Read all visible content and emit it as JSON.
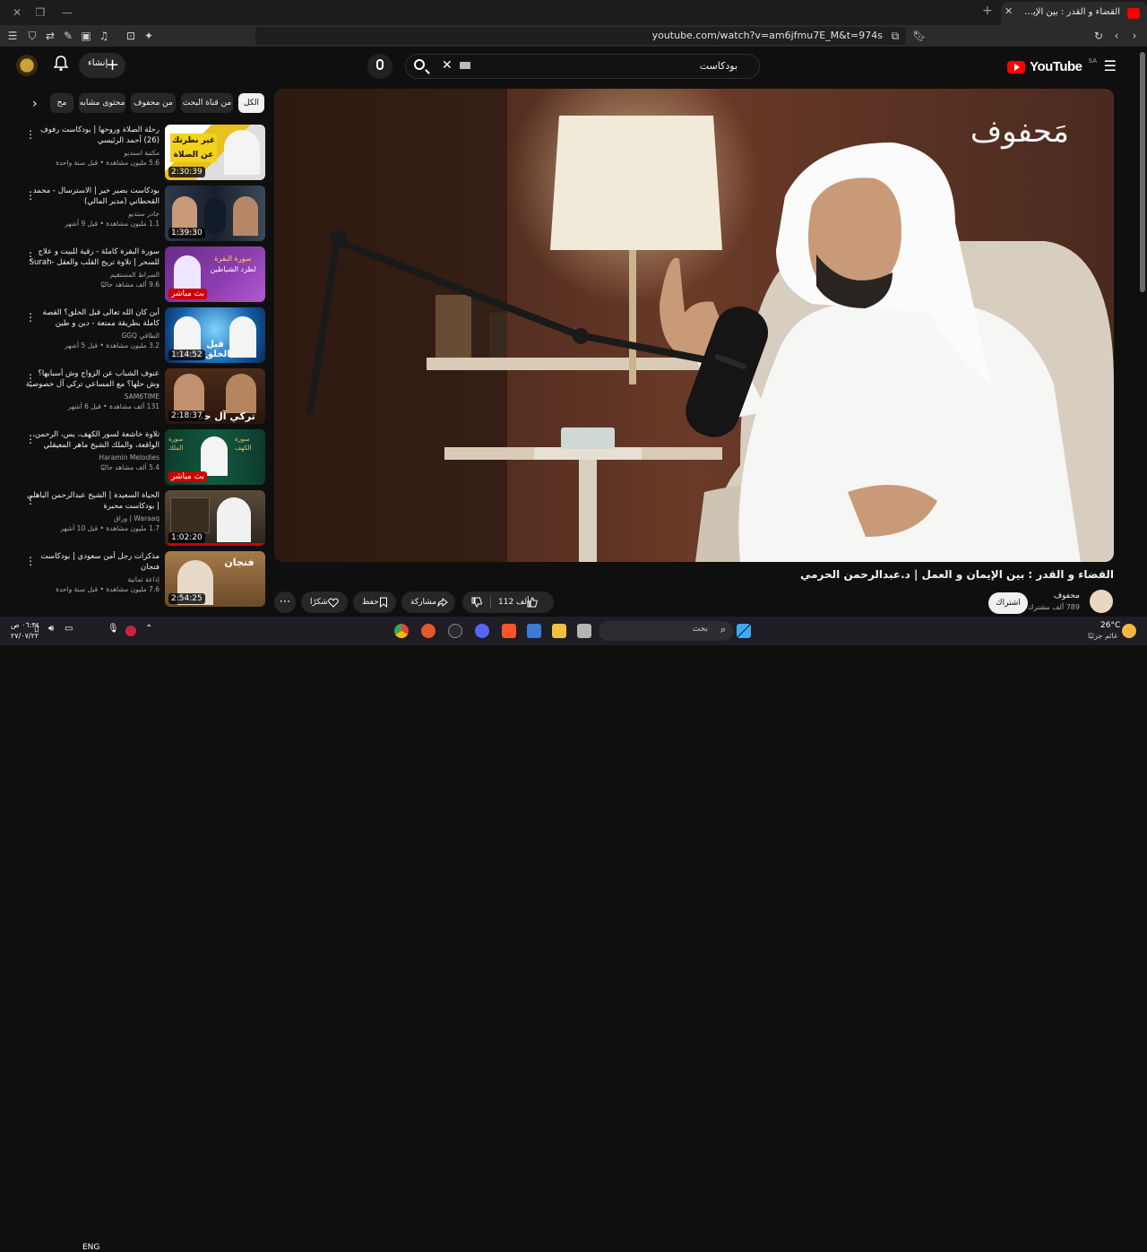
{
  "browser": {
    "tab_title": "القضاء و القدر : بين الإيمان و الك",
    "url": "youtube.com/watch?v=am6jfmu7E_M&t=974s"
  },
  "header": {
    "logo_text": "YouTube",
    "region": "SA",
    "search_value": "بودكاست",
    "create_label": "إنشاء"
  },
  "chips": [
    "الكل",
    "من قناة البحث",
    "من محفوف",
    "محتوى مشابه",
    "مح"
  ],
  "sidebar": {
    "items": [
      {
        "title": "رحلة الصلاة وروحها | بودكاست رفوف (26) أحمد الرئيسي",
        "channel": "مكتبة استديو",
        "views": "5.6 مليون مشاهدة • قبل سنة واحدة",
        "duration": "2:30:39"
      },
      {
        "title": "بودكاست بصير خير | الاسترسال - محمد القحطاني (مدير المالي)",
        "channel": "جادر ستديو",
        "views": "1.1 مليون مشاهدة • قبل 9 أشهر",
        "duration": "1:39:30"
      },
      {
        "title": "سورة البقرة كاملة - رقية للبيت و علاج للسحر | تلاوة تريح القلب والعقل -Surah Al...",
        "channel": "الصراط المستقيم",
        "views": "9.6 ألف مشاهد حاليًا",
        "duration": "بث مباشر"
      },
      {
        "title": "أين كان الله تعالى قبل الخلق؟ القصة كاملة بطريقة ممتعة - دين و طين",
        "channel": "الطاقي GGQ",
        "views": "3.2 مليون مشاهدة • قبل 5 أشهر",
        "duration": "1:14:52"
      },
      {
        "title": "عنوف الشباب عن الزواج وش أسبابها؟ وش حلها؟ مع المساعي تركي آل خصوصية في ...",
        "channel": "SAM6TIME",
        "views": "131 ألف مشاهدة • قبل 6 أشهر",
        "duration": "2:18:37"
      },
      {
        "title": "تلاوة خاشعة لسور الكهف، يس، الرحمن، الواقعة، والملك الشيخ ماهر المعيقلي لتيسير...",
        "channel": "Haramin Melodies",
        "views": "5.4 ألف مشاهد حاليًا",
        "duration": "بث مباشر"
      },
      {
        "title": "الحياة السعيدة | الشيخ عبدالرحمن الباهلي | بودكاست محبرة",
        "channel": "Waraaq | وراق",
        "views": "1.7 مليون مشاهدة • قبل 10 أشهر",
        "duration": "1:02:20"
      },
      {
        "title": "مذكرات رجل أمن سعودي | بودكاست فنجان",
        "channel": "إذاعة ثمانية",
        "views": "7.6 مليون مشاهدة • قبل سنة واحدة",
        "duration": "2:54:25"
      }
    ]
  },
  "player": {
    "watermark": "مَحفوف"
  },
  "video": {
    "title": "القضاء و القدر : بين الإيمان و العمل | د.عبدالرحمن الحرمي",
    "channel_name": "محفوف",
    "subscribers": "789 ألف مشترك",
    "subscribe_label": "اشتراك",
    "likes": "112 ألف",
    "share_label": "مشاركة",
    "save_label": "حفظ",
    "thanks_label": "شكرًا"
  },
  "taskbar": {
    "search_placeholder": "بحث",
    "language": "ENG",
    "time": "٠٦:٣٤ ص",
    "date": "٢٧/٠٧/٢٢",
    "weather_temp": "26°C",
    "weather_desc": "غائم جزئيًا"
  }
}
